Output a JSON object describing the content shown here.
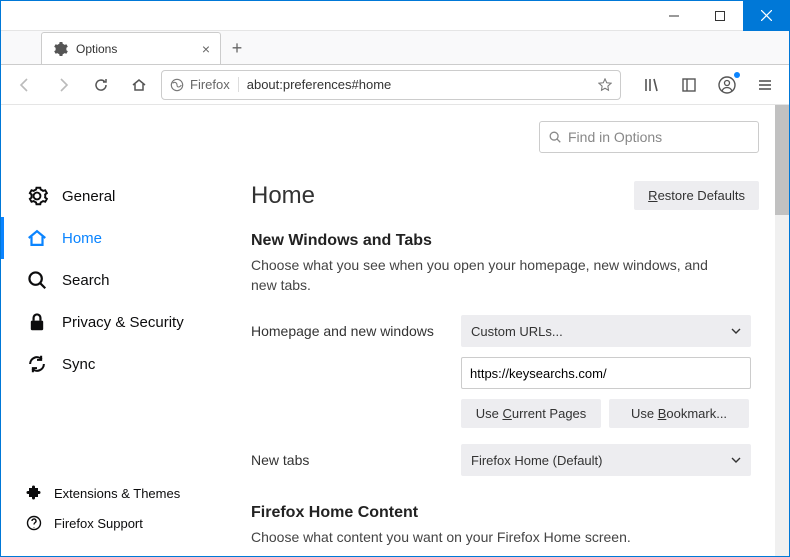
{
  "window": {
    "tab_title": "Options"
  },
  "urlbar": {
    "identity_label": "Firefox",
    "url": "about:preferences#home"
  },
  "search": {
    "placeholder": "Find in Options"
  },
  "sidebar": {
    "items": [
      {
        "label": "General"
      },
      {
        "label": "Home"
      },
      {
        "label": "Search"
      },
      {
        "label": "Privacy & Security"
      },
      {
        "label": "Sync"
      }
    ],
    "bottom": [
      {
        "label": "Extensions & Themes"
      },
      {
        "label": "Firefox Support"
      }
    ]
  },
  "page": {
    "title": "Home",
    "restore_defaults": "Restore Defaults",
    "section1": {
      "title": "New Windows and Tabs",
      "desc": "Choose what you see when you open your homepage, new windows, and new tabs.",
      "homepage_label": "Homepage and new windows",
      "homepage_select": "Custom URLs...",
      "homepage_url": "https://keysearchs.com/",
      "use_current": "Use Current Pages",
      "use_bookmark": "Use Bookmark...",
      "newtabs_label": "New tabs",
      "newtabs_select": "Firefox Home (Default)"
    },
    "section2": {
      "title": "Firefox Home Content",
      "desc": "Choose what content you want on your Firefox Home screen."
    }
  }
}
